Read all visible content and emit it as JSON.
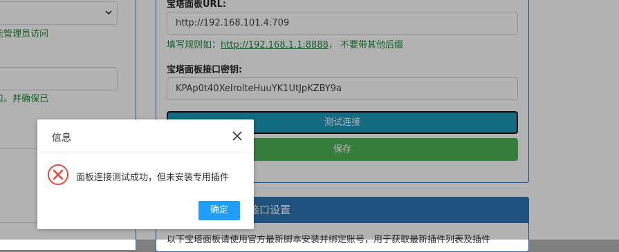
{
  "left": {
    "hint1": "能管理员访问",
    "hint2": "口。并确保已"
  },
  "form": {
    "url_label": "宝塔面板URL:",
    "url_value": "http://192.168.101.4:709",
    "hint_prefix": "填写规则如：",
    "hint_link": "http://192.168.1.1:8888",
    "hint_suffix": "， 不要带其他后缀",
    "key_label": "宝塔面板接口密钥:",
    "key_value": "KPAp0t40XeIrolteHuuYK1UtJpKZBY9a",
    "test_button": "测试连接",
    "save_button": "保存"
  },
  "section2": {
    "title": "接口设置",
    "text": "以下宝塔面板请使用官方最新脚本安装并绑定账号，用于获取最新插件列表及插件"
  },
  "dialog": {
    "title": "信息",
    "message": "面板连接测试成功，但未安装专用插件",
    "ok_button": "确定",
    "icon": "error-circle-icon",
    "close_icon": "close-icon"
  },
  "colors": {
    "test_button": "#1b9ab8",
    "save_button": "#4fb559",
    "hint_green": "#1f8a3a",
    "ok_button": "#1e9fff",
    "error_red": "#e8473f",
    "panel_border": "#2a72b8"
  }
}
